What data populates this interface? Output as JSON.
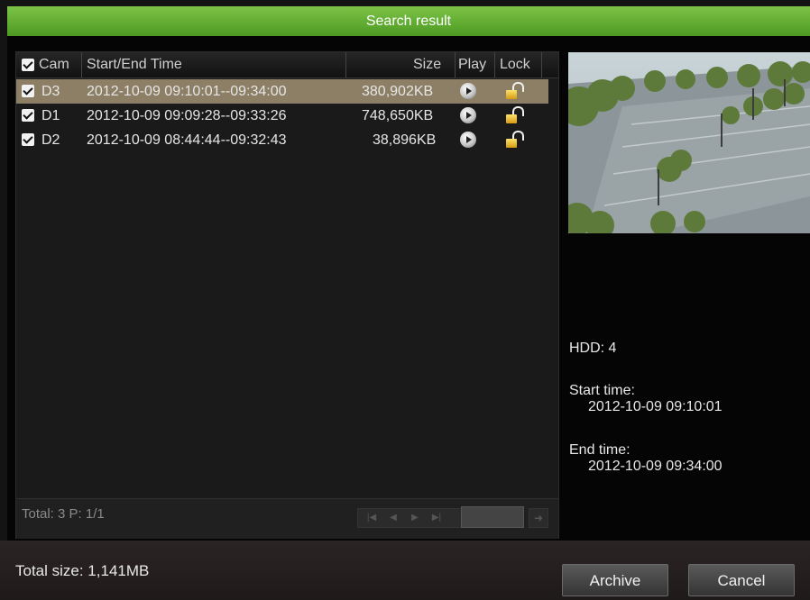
{
  "window": {
    "title": "Search result"
  },
  "table": {
    "columns": {
      "cam": "Cam",
      "time": "Start/End Time",
      "size": "Size",
      "play": "Play",
      "lock": "Lock"
    },
    "select_all_checked": true,
    "rows": [
      {
        "checked": true,
        "cam": "D3",
        "time": "2012-10-09 09:10:01--09:34:00",
        "size": "380,902KB",
        "play_icon": "play-icon",
        "lock_icon": "unlocked-icon",
        "selected": true
      },
      {
        "checked": true,
        "cam": "D1",
        "time": "2012-10-09 09:09:28--09:33:26",
        "size": "748,650KB",
        "play_icon": "play-icon",
        "lock_icon": "unlocked-icon",
        "selected": false
      },
      {
        "checked": true,
        "cam": "D2",
        "time": "2012-10-09 08:44:44--09:32:43",
        "size": "38,896KB",
        "play_icon": "play-icon",
        "lock_icon": "unlocked-icon",
        "selected": false
      }
    ]
  },
  "footer": {
    "total_label": "Total: 3  P: 1/1",
    "page_input": "",
    "pager_icons": [
      "first-page-icon",
      "prev-page-icon",
      "next-page-icon",
      "last-page-icon",
      "go-icon"
    ]
  },
  "details": {
    "hdd": "HDD: 4",
    "start_label": "Start time:",
    "start_value": "2012-10-09 09:10:01",
    "end_label": "End time:",
    "end_value": "2012-10-09 09:34:00"
  },
  "bottom": {
    "total_size": "Total size: 1,141MB",
    "archive_label": "Archive",
    "cancel_label": "Cancel"
  },
  "colors": {
    "title_bar": "#5faf2f",
    "selected_row": "#8c7f65",
    "background": "#141414"
  }
}
